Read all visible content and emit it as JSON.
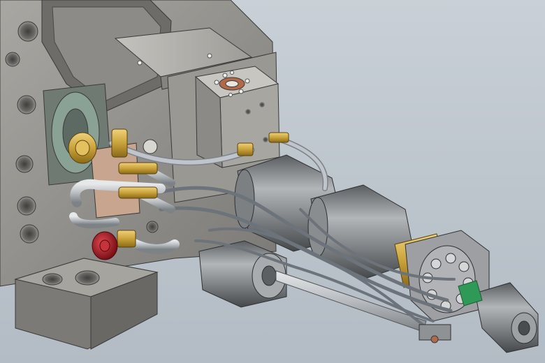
{
  "viewport": {
    "background": "#bcc4cc",
    "type": "3d-cad-assembly-render"
  },
  "colors": {
    "body_steel": "#8e8c88",
    "body_dark": "#5f5e5b",
    "body_light": "#b4b2ad",
    "cylinder": "#8f9295",
    "brass": "#c9a23a",
    "red_knob": "#b0202a",
    "green_clip": "#2f9a58",
    "copper_port": "#b06a4a",
    "hose": "#a6acb4"
  }
}
